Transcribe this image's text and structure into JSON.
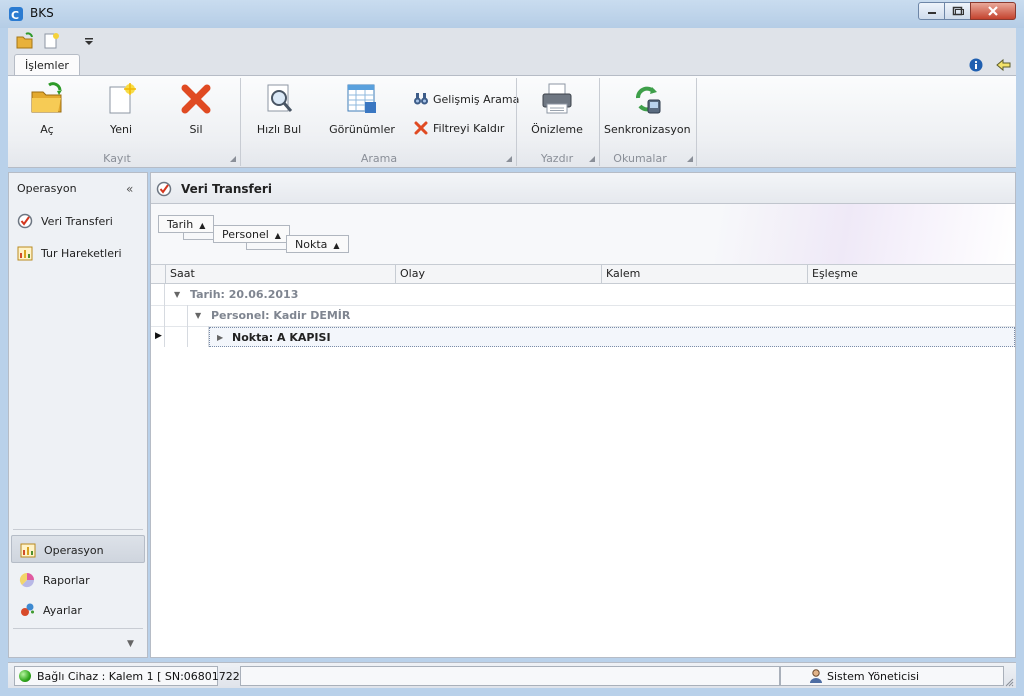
{
  "window": {
    "title": "BKS",
    "app_icon": "bks-app-icon",
    "controls": [
      "minimize-icon",
      "maximize-icon",
      "close-icon"
    ]
  },
  "quick_access": {
    "icons": [
      "open-folder-icon",
      "new-document-icon",
      "customize-dropdown-icon"
    ]
  },
  "ribbon": {
    "tabs": [
      {
        "label": "İşlemler",
        "active": true
      }
    ],
    "right_icons": [
      "info-icon",
      "back-icon"
    ],
    "groups": [
      {
        "label": "Kayıt",
        "buttons": [
          {
            "label": "Aç",
            "icon": "open-folder-icon"
          },
          {
            "label": "Yeni",
            "icon": "new-document-icon"
          },
          {
            "label": "Sil",
            "icon": "delete-x-icon"
          }
        ]
      },
      {
        "label": "Arama",
        "buttons": [
          {
            "label": "Hızlı Bul",
            "icon": "quick-find-icon"
          },
          {
            "label": "Görünümler",
            "icon": "views-grid-icon"
          }
        ],
        "small_buttons": [
          {
            "label": "Gelişmiş Arama",
            "icon": "binoculars-icon"
          },
          {
            "label": "Filtreyi Kaldır",
            "icon": "remove-filter-icon"
          }
        ]
      },
      {
        "label": "Yazdır",
        "buttons": [
          {
            "label": "Önizleme",
            "icon": "print-preview-icon"
          }
        ]
      },
      {
        "label": "Okumalar",
        "buttons": [
          {
            "label": "Senkronizasyon",
            "icon": "sync-icon"
          }
        ]
      }
    ]
  },
  "nav": {
    "title": "Operasyon",
    "collapse_glyph": "«",
    "items": [
      {
        "label": "Veri Transferi",
        "icon": "data-transfer-icon"
      },
      {
        "label": "Tur Hareketleri",
        "icon": "tour-chart-icon"
      }
    ],
    "groups": [
      {
        "label": "Operasyon",
        "icon": "operation-icon",
        "active": true
      },
      {
        "label": "Raporlar",
        "icon": "reports-icon",
        "active": false
      },
      {
        "label": "Ayarlar",
        "icon": "settings-icon",
        "active": false
      }
    ]
  },
  "main": {
    "title": "Veri Transferi",
    "group_by": [
      {
        "label": "Tarih",
        "sort": "▲"
      },
      {
        "label": "Personel",
        "sort": "▲"
      },
      {
        "label": "Nokta",
        "sort": "▲"
      }
    ],
    "columns": [
      "Saat",
      "Olay",
      "Kalem",
      "Eşleşme"
    ],
    "rows": [
      {
        "level": 0,
        "text": "Tarih: 20.06.2013",
        "expanded": true
      },
      {
        "level": 1,
        "text": "Personel: Kadir DEMİR",
        "expanded": true
      },
      {
        "level": 2,
        "text": "Nokta: A KAPISI",
        "expanded": false,
        "focused": true
      }
    ]
  },
  "status": {
    "device": "Bağlı Cihaz : Kalem 1 [ SN:06801722 ]",
    "user": "Sistem Yöneticisi",
    "device_status_color": "#2fa61b"
  }
}
